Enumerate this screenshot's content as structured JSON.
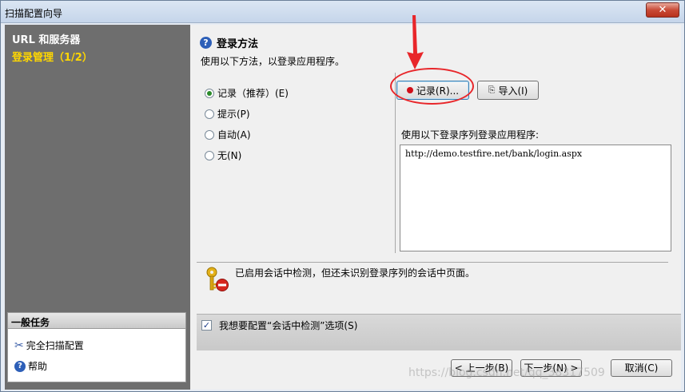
{
  "window": {
    "title": "扫描配置向导",
    "close_label": "✕"
  },
  "left": {
    "heading": "URL 和服务器",
    "step": "登录管理（1/2）",
    "tasks": {
      "header": "一般任务",
      "items": [
        {
          "label": "完全扫描配置",
          "icon": "tools-icon"
        },
        {
          "label": "帮助",
          "icon": "help-icon"
        }
      ]
    }
  },
  "main": {
    "section_title": "登录方法",
    "section_desc": "使用以下方法，以登录应用程序。",
    "radios": [
      {
        "label": "记录（推荐）(E)",
        "selected": true
      },
      {
        "label": "提示(P)",
        "selected": false
      },
      {
        "label": "自动(A)",
        "selected": false
      },
      {
        "label": "无(N)",
        "selected": false
      }
    ],
    "record_button": "记录(R)...",
    "import_button": "导入(I)",
    "sequence_label": "使用以下登录序列登录应用程序:",
    "sequence_url": "http://demo.testfire.net/bank/login.aspx",
    "info_text": "已启用会话中检测，但还未识别登录序列的会话中页面。",
    "checkbox": {
      "label": "我想要配置“会话中检测”选项(S)",
      "checked": true,
      "mark": "✓"
    }
  },
  "footer": {
    "prev": "< 上一步(B)",
    "next": "下一步(N) >",
    "cancel": "取消(C)"
  },
  "watermark": "https://blog.csdn.net/qq_38317509",
  "colors": {
    "annotation": "#e8262a",
    "left_pane": "#6e6e6e",
    "step_text": "#ffd700"
  }
}
